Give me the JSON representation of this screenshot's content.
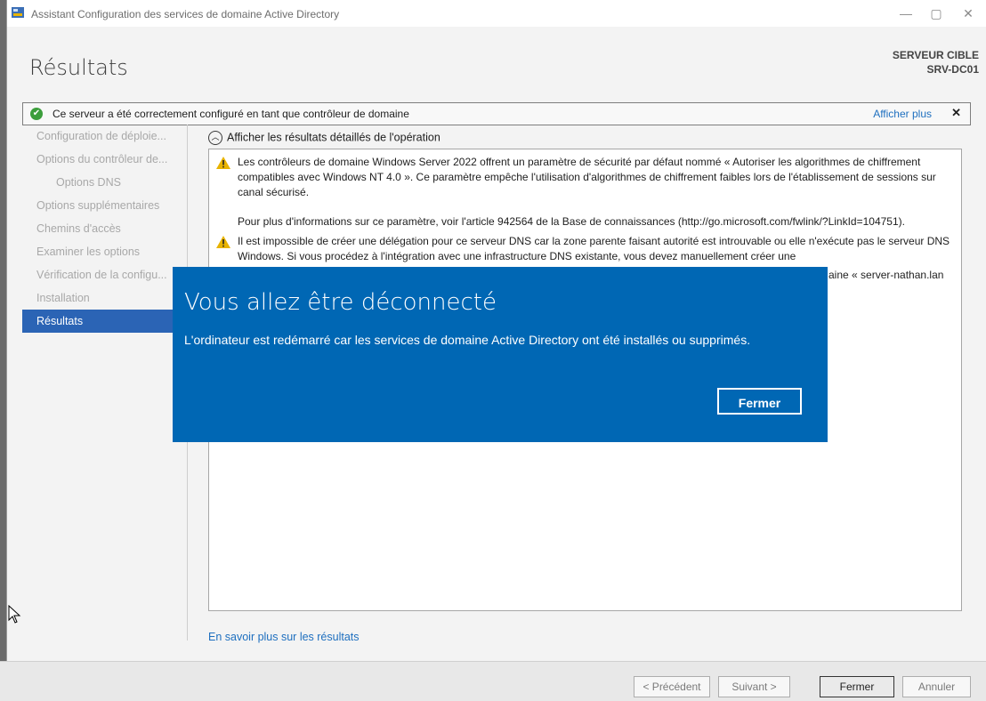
{
  "window": {
    "title": "Assistant Configuration des services de domaine Active Directory",
    "controls": {
      "minimize": "—",
      "maximize": "▢",
      "close": "✕"
    }
  },
  "header": {
    "page_title": "Résultats",
    "server_label": "SERVEUR CIBLE",
    "server_name": "SRV-DC01"
  },
  "notification": {
    "text": "Ce serveur a été correctement configuré en tant que contrôleur de domaine",
    "more": "Afficher plus",
    "close": "✕"
  },
  "sidebar": {
    "items": [
      {
        "label": "Configuration de déploie...",
        "sub": false,
        "active": false
      },
      {
        "label": "Options du contrôleur de...",
        "sub": false,
        "active": false
      },
      {
        "label": "Options DNS",
        "sub": true,
        "active": false
      },
      {
        "label": "Options supplémentaires",
        "sub": false,
        "active": false
      },
      {
        "label": "Chemins d'accès",
        "sub": false,
        "active": false
      },
      {
        "label": "Examiner les options",
        "sub": false,
        "active": false
      },
      {
        "label": "Vérification de la configu...",
        "sub": false,
        "active": false
      },
      {
        "label": "Installation",
        "sub": false,
        "active": false
      },
      {
        "label": "Résultats",
        "sub": false,
        "active": true
      }
    ]
  },
  "main": {
    "expand_label": "Afficher les résultats détaillés de l'opération",
    "messages": [
      "Les contrôleurs de domaine Windows Server 2022 offrent un paramètre de sécurité par défaut nommé « Autoriser les algorithmes de chiffrement compatibles avec Windows NT 4.0 ». Ce paramètre empêche l'utilisation d'algorithmes de chiffrement faibles lors de l'établissement de sessions sur canal sécurisé.",
      "Pour plus d'informations sur ce paramètre, voir l'article 942564 de la Base de connaissances (http://go.microsoft.com/fwlink/?LinkId=104751).",
      "Il est impossible de créer une délégation pour ce serveur DNS car la zone parente faisant autorité est introuvable ou elle n'exécute pas le serveur DNS Windows. Si vous procédez à l'intégration avec une infrastructure DNS existante, vous devez manuellement créer une",
      "aine « server-nathan.lan"
    ],
    "learn_more": "En savoir plus sur les résultats"
  },
  "footer": {
    "previous": "< Précédent",
    "next": "Suivant >",
    "close": "Fermer",
    "cancel": "Annuler"
  },
  "dialog": {
    "title": "Vous allez être déconnecté",
    "message": "L'ordinateur est redémarré car les services de domaine Active Directory ont été installés ou supprimés.",
    "button": "Fermer"
  },
  "colors": {
    "dialog_bg": "#0067b4",
    "nav_active": "#2b64b5",
    "link": "#1e6fbf",
    "success": "#3c9e3c",
    "warning": "#e8b300"
  }
}
